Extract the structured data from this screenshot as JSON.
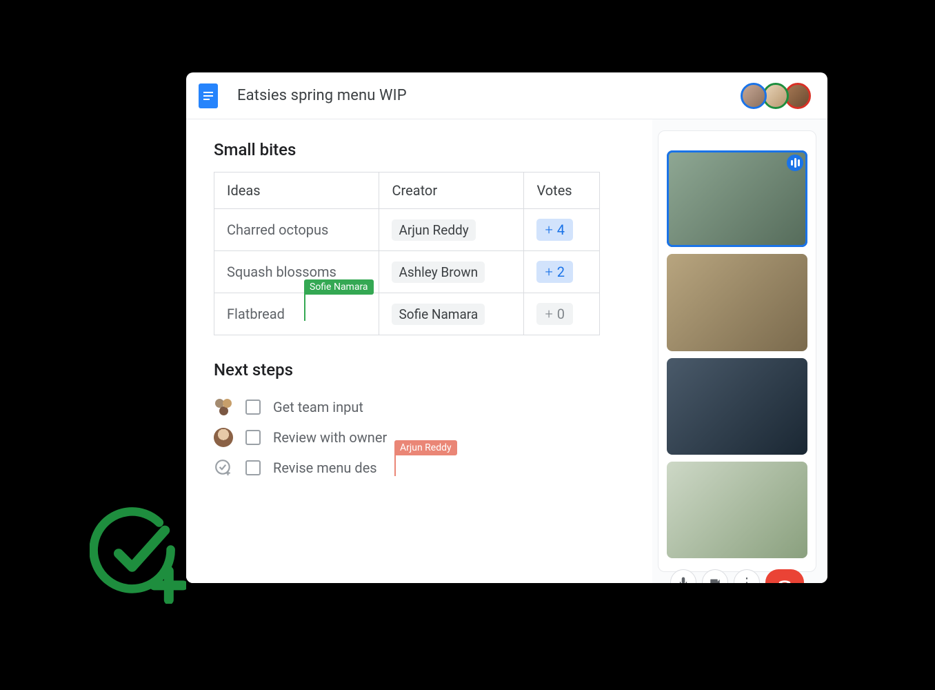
{
  "doc": {
    "title": "Eatsies spring menu WIP"
  },
  "section1_heading": "Small bites",
  "table": {
    "headers": {
      "ideas": "Ideas",
      "creator": "Creator",
      "votes": "Votes"
    },
    "rows": [
      {
        "idea": "Charred octopus",
        "creator": "Arjun Reddy",
        "votes": "4",
        "vote_style": "pos"
      },
      {
        "idea": "Squash blossoms",
        "creator": "Ashley Brown",
        "votes": "2",
        "vote_style": "pos"
      },
      {
        "idea": "Flatbread",
        "creator": "Sofie Namara",
        "votes": "0",
        "vote_style": "zero"
      }
    ]
  },
  "cursor_green": "Sofie Namara",
  "section2_heading": "Next steps",
  "tasks": [
    {
      "label": "Get team input"
    },
    {
      "label": "Review with owner"
    },
    {
      "label": "Revise menu des"
    }
  ],
  "cursor_red": "Arjun Reddy",
  "colors": {
    "blue": "#1a73e8",
    "green": "#34a853",
    "red": "#ea4335"
  }
}
